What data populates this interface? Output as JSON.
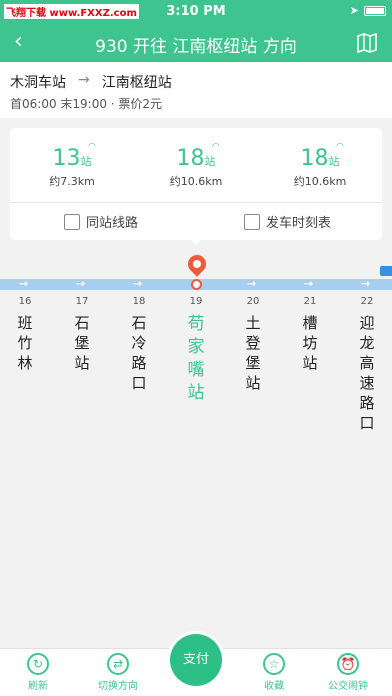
{
  "status": {
    "watermark": "飞翔下载 www.FXXZ.com",
    "time": "3:10 PM"
  },
  "header": {
    "title": "930 开往 江南枢纽站 方向"
  },
  "route": {
    "from": "木洞车站",
    "arrow": "→",
    "to": "江南枢纽站",
    "meta": "首06:00 末19:00 · 票价2元"
  },
  "arrivals": [
    {
      "count": "13",
      "unit": "站",
      "dist": "约7.3km"
    },
    {
      "count": "18",
      "unit": "站",
      "dist": "约10.6km"
    },
    {
      "count": "18",
      "unit": "站",
      "dist": "约10.6km"
    }
  ],
  "actions": {
    "same_station": "同站线路",
    "timetable": "发车时刻表"
  },
  "stops": [
    {
      "idx": "16",
      "name": "班\n竹\n林"
    },
    {
      "idx": "17",
      "name": "石\n堡\n站"
    },
    {
      "idx": "18",
      "name": "石\n冷\n路\n口"
    },
    {
      "idx": "19",
      "name": "苟\n家\n嘴\n站"
    },
    {
      "idx": "20",
      "name": "土\n登\n堡\n站"
    },
    {
      "idx": "21",
      "name": "槽\n坊\n站"
    },
    {
      "idx": "22",
      "name": "迎\n龙\n高\n速\n路\n口"
    }
  ],
  "tabbar": {
    "refresh": "刷新",
    "switch": "切换方向",
    "pay": "支付",
    "collect": "收藏",
    "ad": "公交闹钟"
  },
  "colors": {
    "accent": "#3dc48f",
    "line": "#a7cdef",
    "pin": "#f05a3c"
  }
}
